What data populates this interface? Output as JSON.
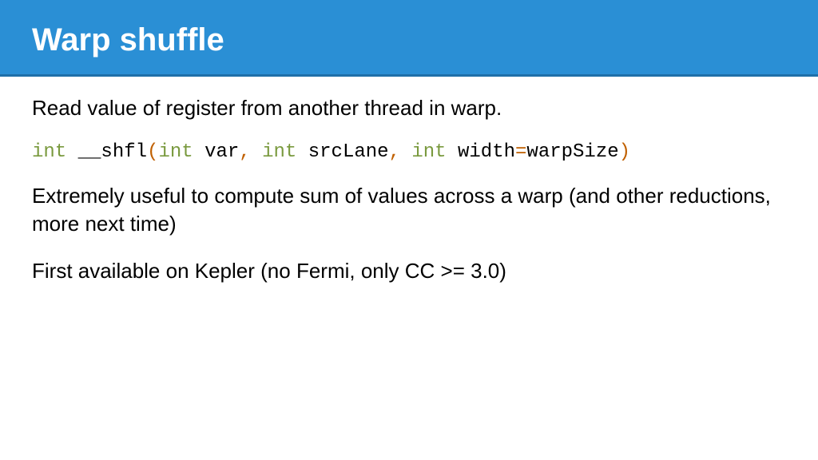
{
  "header": {
    "title": "Warp shuffle"
  },
  "body": {
    "p1": "Read value of register from another thread in warp.",
    "code": {
      "t_int1": "int",
      "t_sp1": " ",
      "t_fn": "__shfl",
      "t_lp": "(",
      "t_int2": "int",
      "t_sp2": " ",
      "t_var": "var",
      "t_c1": ",",
      "t_sp3": " ",
      "t_int3": "int",
      "t_sp4": " ",
      "t_src": "srcLane",
      "t_c2": ",",
      "t_sp5": " ",
      "t_int4": "int",
      "t_sp6": " ",
      "t_width": "width",
      "t_eq": "=",
      "t_ws": "warpSize",
      "t_rp": ")"
    },
    "p2": "Extremely useful to compute sum of values across a warp (and other reductions, more next time)",
    "p3": "First available on Kepler (no Fermi, only CC >= 3.0)"
  }
}
